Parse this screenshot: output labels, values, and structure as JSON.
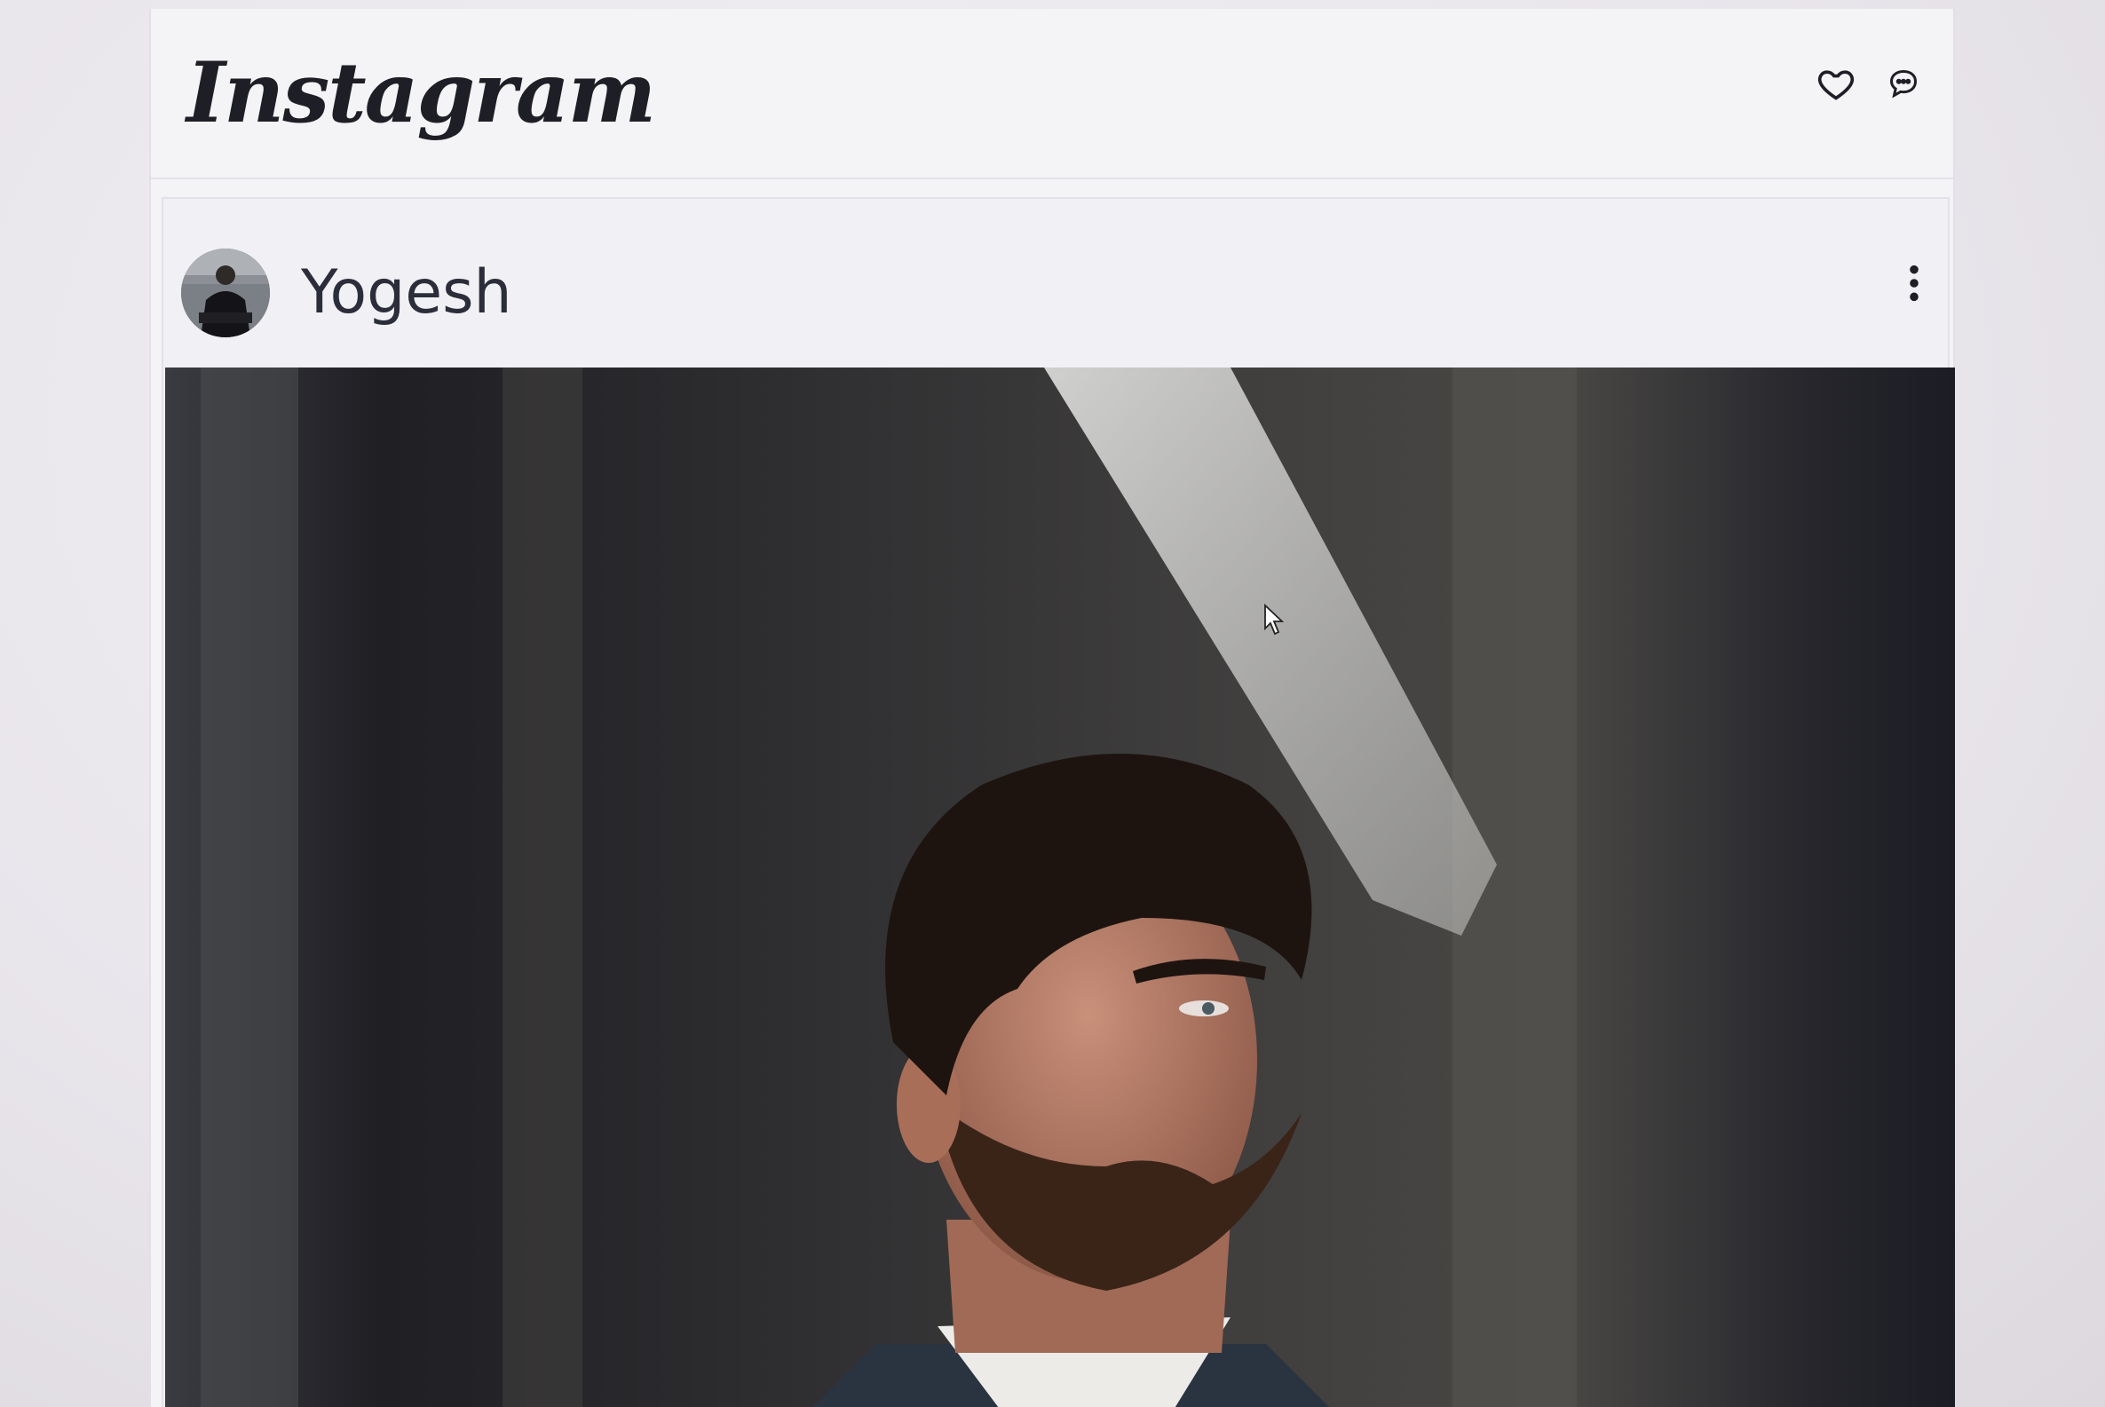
{
  "app": {
    "logo_text": "Instagram",
    "header_icons": [
      "heart-icon",
      "chat-bubble-icon"
    ]
  },
  "post": {
    "username": "Yogesh",
    "menu_icon": "vertical-dots-icon",
    "avatar_icon": "user-avatar-photo",
    "image_description_icon": "portrait-photo"
  },
  "colors": {
    "background": "#ebe8ee",
    "card": "#f4f3f6",
    "text_primary": "#2b2d3a",
    "logo": "#1e1e26"
  }
}
